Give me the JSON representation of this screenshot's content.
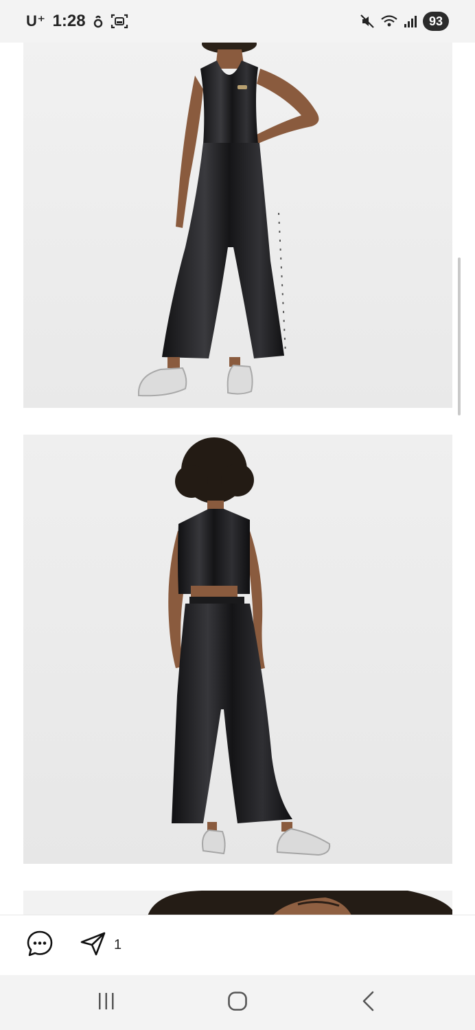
{
  "status_bar": {
    "carrier": "U⁺",
    "time": "1:28",
    "battery": "93",
    "icons": [
      "touch-icon",
      "screenshot-icon",
      "mute-icon",
      "wifi-icon",
      "signal-icon"
    ]
  },
  "feed": {
    "photos": [
      {
        "subject": "model-front-jumpsuit"
      },
      {
        "subject": "model-back-jumpsuit"
      },
      {
        "subject": "model-head-partial"
      }
    ]
  },
  "actions": {
    "comment_icon": "comment-icon",
    "share_icon": "send-icon",
    "share_count": "1"
  },
  "nav": {
    "recent": "recent-apps-icon",
    "home": "home-icon",
    "back": "back-icon"
  },
  "colors": {
    "status_bg": "#f3f3f3",
    "photo_bg": "#eeeeee",
    "garment": "#1c1c1e"
  }
}
